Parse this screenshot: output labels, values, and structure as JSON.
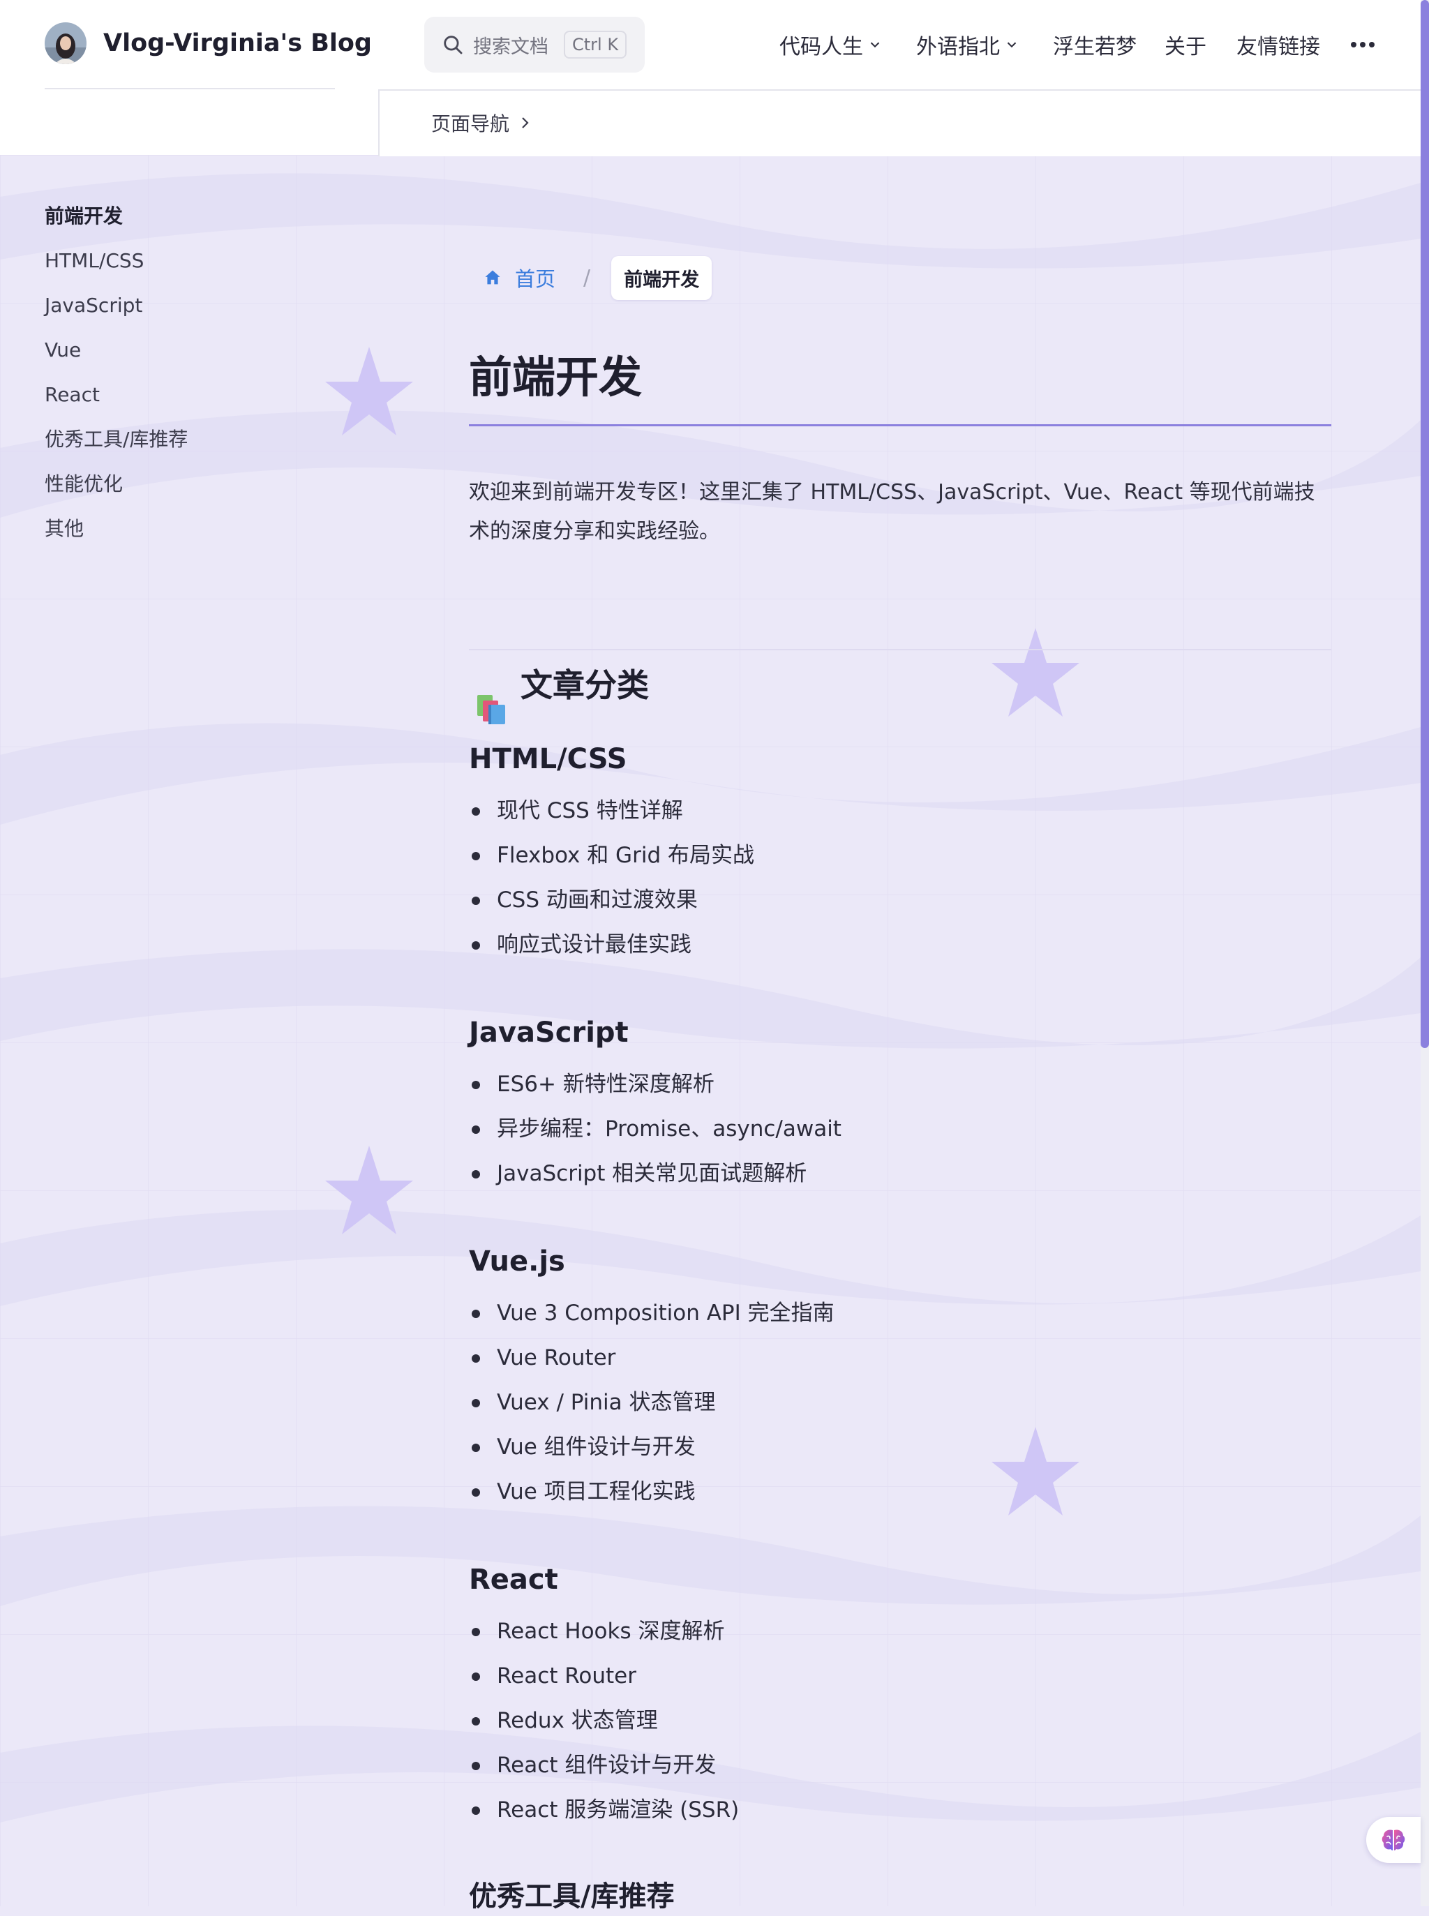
{
  "site": {
    "title": "Vlog-Virginia's Blog"
  },
  "search": {
    "placeholder": "搜索文档",
    "shortcut": "Ctrl K"
  },
  "nav": {
    "items": [
      {
        "label": "代码人生",
        "dropdown": true
      },
      {
        "label": "外语指北",
        "dropdown": true
      },
      {
        "label": "浮生若梦",
        "dropdown": false
      },
      {
        "label": "关于",
        "dropdown": false
      },
      {
        "label": "友情链接",
        "dropdown": false
      }
    ],
    "more_icon": "more-dots-icon"
  },
  "local_nav": {
    "label": "页面导航"
  },
  "sidebar": {
    "items": [
      {
        "label": "前端开发",
        "active": true
      },
      {
        "label": "HTML/CSS"
      },
      {
        "label": "JavaScript"
      },
      {
        "label": "Vue"
      },
      {
        "label": "React"
      },
      {
        "label": "优秀工具/库推荐"
      },
      {
        "label": "性能优化"
      },
      {
        "label": "其他"
      }
    ]
  },
  "breadcrumb": {
    "home": "首页",
    "separator": "/",
    "current": "前端开发"
  },
  "main": {
    "title": "前端开发",
    "intro": "欢迎来到前端开发专区！这里汇集了 HTML/CSS、JavaScript、Vue、React 等现代前端技术的深度分享和实践经验。",
    "section_title": "文章分类",
    "categories": [
      {
        "title": "HTML/CSS",
        "items": [
          "现代 CSS 特性详解",
          "Flexbox 和 Grid 布局实战",
          "CSS 动画和过渡效果",
          "响应式设计最佳实践"
        ]
      },
      {
        "title": "JavaScript",
        "items": [
          "ES6+ 新特性深度解析",
          "异步编程：Promise、async/await",
          "JavaScript 相关常见面试题解析"
        ]
      },
      {
        "title": "Vue.js",
        "items": [
          "Vue 3 Composition API 完全指南",
          "Vue Router",
          "Vuex / Pinia 状态管理",
          "Vue 组件设计与开发",
          "Vue 项目工程化实践"
        ]
      },
      {
        "title": "React",
        "items": [
          "React Hooks 深度解析",
          "React Router",
          "Redux 状态管理",
          "React 组件设计与开发",
          "React 服务端渲染 (SSR)"
        ]
      },
      {
        "title": "优秀工具/库推荐",
        "items": []
      }
    ]
  },
  "colors": {
    "accent": "#8b80de",
    "link": "#3b7ddd",
    "background": "#ebe8f8",
    "star": "#cfc6f6"
  }
}
